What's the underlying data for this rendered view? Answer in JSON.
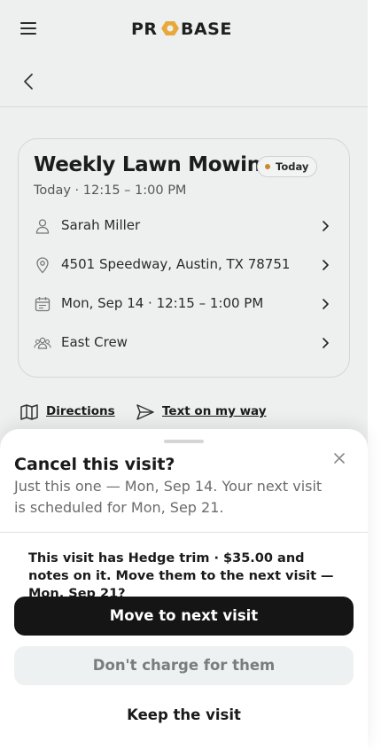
{
  "app": {
    "logo_text": "PROBASE"
  },
  "visit": {
    "title": "Weekly Lawn Mowing",
    "badge": "Today",
    "time_summary": "Today · 12:15 – 1:00 PM",
    "rows": [
      {
        "icon": "person-icon",
        "label": "Sarah Miller"
      },
      {
        "icon": "location-pin-icon",
        "label": "4501 Speedway, Austin, TX 78751"
      },
      {
        "icon": "calendar-icon",
        "label": "Mon, Sep 14 · 12:15 – 1:00 PM"
      },
      {
        "icon": "crew-icon",
        "label": "East Crew"
      }
    ]
  },
  "actions": {
    "directions": "Directions",
    "text_on_my_way": "Text on my way"
  },
  "sheet": {
    "title": "Cancel this visit?",
    "subtitle": "Just this one — Mon, Sep 14. Your next visit is scheduled for Mon, Sep 21.",
    "message": "This visit has Hedge trim · $35.00 and notes on it. Move them to the next visit — Mon, Sep 21?",
    "primary_button": "Move to next visit",
    "secondary_button": "Don't charge for them",
    "tertiary_button": "Keep the visit"
  },
  "colors": {
    "badge_dot": "#c98a2e",
    "logo_accent": "#e7a93a",
    "primary_button": "#151515"
  }
}
